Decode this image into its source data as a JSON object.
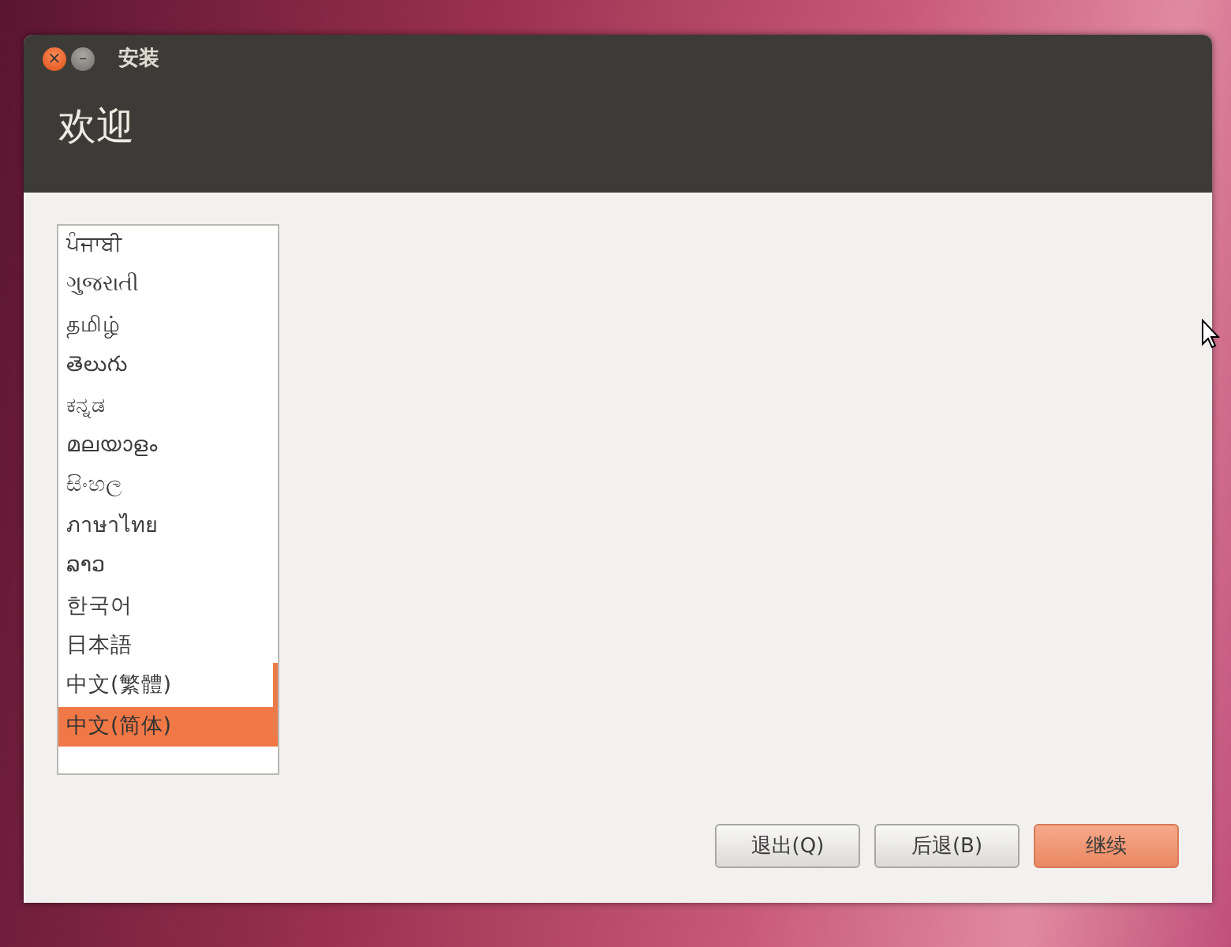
{
  "window": {
    "title": "安装",
    "close_button": "×",
    "minimize_button": "–"
  },
  "header": {
    "title": "欢迎"
  },
  "languages": [
    {
      "label": "ਪੰਜਾਬੀ",
      "selected": false
    },
    {
      "label": "ગુજરાતી",
      "selected": false
    },
    {
      "label": "தமிழ்",
      "selected": false
    },
    {
      "label": "తెలుగు",
      "selected": false
    },
    {
      "label": "ಕನ್ನಡ",
      "selected": false
    },
    {
      "label": "മലയാളം",
      "selected": false
    },
    {
      "label": "සිංහල",
      "selected": false
    },
    {
      "label": "ภาษาไทย",
      "selected": false
    },
    {
      "label": "ລາວ",
      "selected": false
    },
    {
      "label": "한국어",
      "selected": false
    },
    {
      "label": "日本語",
      "selected": false
    },
    {
      "label": "中文(繁體)",
      "selected": false
    },
    {
      "label": "中文(简体)",
      "selected": true
    }
  ],
  "buttons": [
    {
      "label": "退出(Q)",
      "kind": "normal"
    },
    {
      "label": "后退(B)",
      "kind": "normal"
    },
    {
      "label": "继续",
      "kind": "primary"
    }
  ]
}
